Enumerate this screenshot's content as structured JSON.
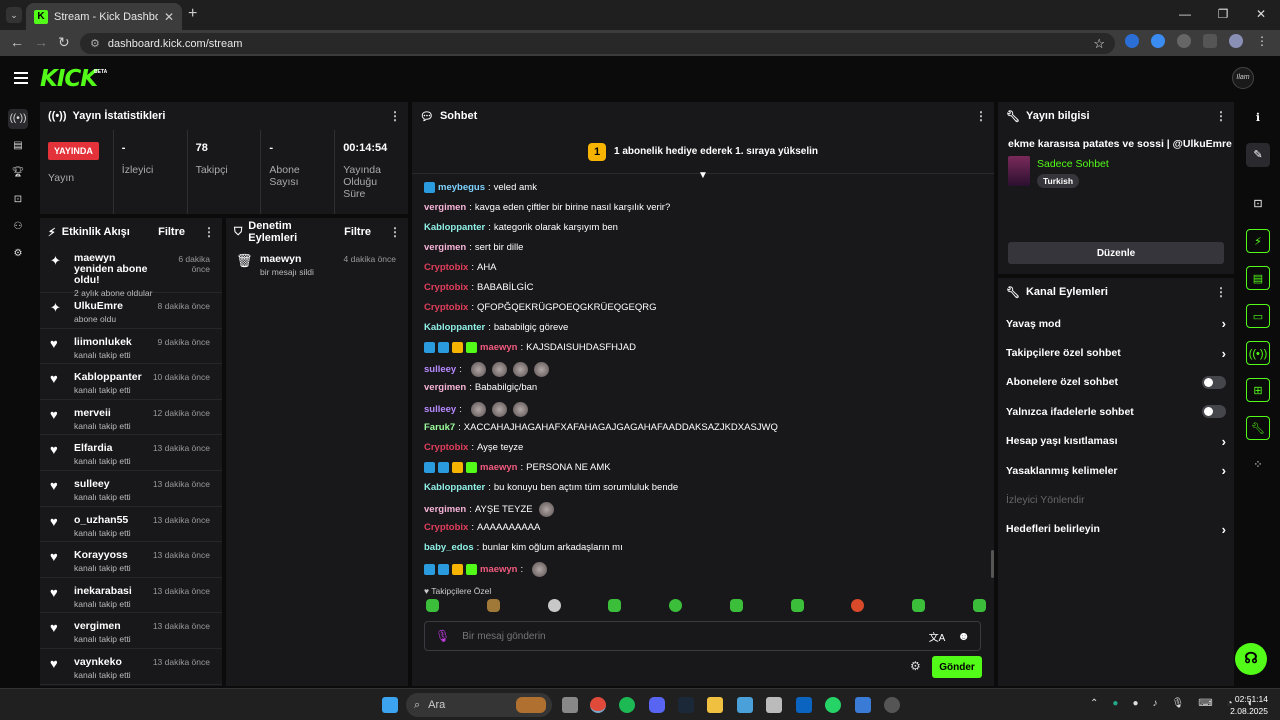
{
  "browser": {
    "tab_title": "Stream - Kick Dashboard",
    "url": "dashboard.kick.com/stream",
    "tab_favicon": "K"
  },
  "header": {
    "logo": "KICK",
    "beta": "BETA",
    "avatar_text": "Ilam"
  },
  "stats": {
    "title": "Yayın İstatistikleri",
    "live_badge": "YAYINDA",
    "cells": [
      {
        "value": "",
        "label": "Yayın"
      },
      {
        "value": "-",
        "label": "İzleyici"
      },
      {
        "value": "78",
        "label": "Takipçi"
      },
      {
        "value": "-",
        "label": "Abone Sayısı"
      },
      {
        "value": "00:14:54",
        "label": "Yayında Olduğu Süre"
      }
    ]
  },
  "activity": {
    "title": "Etkinlik Akışı",
    "filter": "Filtre",
    "items": [
      {
        "name": "maewyn yeniden abone oldu!",
        "sub": "2 aylık abone oldular",
        "time": "6 dakika önce",
        "icon": "sparkle-icon"
      },
      {
        "name": "UlkuEmre",
        "sub": "abone oldu",
        "time": "8 dakika önce",
        "icon": "sparkle-icon"
      },
      {
        "name": "liimonlukek",
        "sub": "kanalı takip etti",
        "time": "9 dakika önce",
        "icon": "heart-icon"
      },
      {
        "name": "Kabloppanter",
        "sub": "kanalı takip etti",
        "time": "10 dakika önce",
        "icon": "heart-icon"
      },
      {
        "name": "merveii",
        "sub": "kanalı takip etti",
        "time": "12 dakika önce",
        "icon": "heart-icon"
      },
      {
        "name": "Elfardia",
        "sub": "kanalı takip etti",
        "time": "13 dakika önce",
        "icon": "heart-icon"
      },
      {
        "name": "sulleey",
        "sub": "kanalı takip etti",
        "time": "13 dakika önce",
        "icon": "heart-icon"
      },
      {
        "name": "o_uzhan55",
        "sub": "kanalı takip etti",
        "time": "13 dakika önce",
        "icon": "heart-icon"
      },
      {
        "name": "Korayyoss",
        "sub": "kanalı takip etti",
        "time": "13 dakika önce",
        "icon": "heart-icon"
      },
      {
        "name": "inekarabasi",
        "sub": "kanalı takip etti",
        "time": "13 dakika önce",
        "icon": "heart-icon"
      },
      {
        "name": "vergimen",
        "sub": "kanalı takip etti",
        "time": "13 dakika önce",
        "icon": "heart-icon"
      },
      {
        "name": "vaynkeko",
        "sub": "kanalı takip etti",
        "time": "13 dakika önce",
        "icon": "heart-icon"
      }
    ]
  },
  "moderation": {
    "title": "Denetim Eylemleri",
    "filter": "Filtre",
    "items": [
      {
        "name": "maewyn",
        "sub": "bir mesajı sildi",
        "time": "4 dakika önce"
      }
    ]
  },
  "chat": {
    "title": "Sohbet",
    "pinned_coin": "1",
    "pinned_text": "1 abonelik hediye ederek 1. sıraya yükselin",
    "messages": [
      {
        "user": "meybegus",
        "color": "#7fd3ff",
        "text": "veled amk",
        "badges": [
          "#2b9be0"
        ]
      },
      {
        "user": "vergimen",
        "color": "#f7b4d7",
        "text": "kavga eden çiftler bir birine nasıl karşılık verir?"
      },
      {
        "user": "Kabloppanter",
        "color": "#8ff0e6",
        "text": "kategorik olarak karşıyım ben"
      },
      {
        "user": "vergimen",
        "color": "#f7b4d7",
        "text": "sert bir dille"
      },
      {
        "user": "Cryptobix",
        "color": "#e23e5b",
        "text": "AHA"
      },
      {
        "user": "Cryptobix",
        "color": "#e23e5b",
        "text": "BABABİLGİC"
      },
      {
        "user": "Cryptobix",
        "color": "#e23e5b",
        "text": "QFOPĞQEKRÜGPOEQGKRÜEQGEQRG"
      },
      {
        "user": "Kabloppanter",
        "color": "#8ff0e6",
        "text": "bababilgiç göreve"
      },
      {
        "user": "maewyn",
        "color": "#f25a7e",
        "text": "KAJSDAISUHDASFHJAD",
        "badges": [
          "#2b9be0",
          "#2b9be0",
          "#f6b400",
          "#53fc18"
        ]
      },
      {
        "user": "sulleey",
        "color": "#b78bff",
        "text": "",
        "emotes": 4
      },
      {
        "user": "vergimen",
        "color": "#f7b4d7",
        "text": "Bababilgiç/ban"
      },
      {
        "user": "sulleey",
        "color": "#b78bff",
        "text": "",
        "emotes": 3
      },
      {
        "user": "Faruk7",
        "color": "#9dff9d",
        "text": "XACCAHAJHAGAHAFXAFAHAGAJGAGAHAFAADDAKSAZJKDXASJWQ"
      },
      {
        "user": "Cryptobix",
        "color": "#e23e5b",
        "text": "Ayşe teyze"
      },
      {
        "user": "maewyn",
        "color": "#f25a7e",
        "text": "PERSONA NE AMK",
        "badges": [
          "#2b9be0",
          "#2b9be0",
          "#f6b400",
          "#53fc18"
        ]
      },
      {
        "user": "Kabloppanter",
        "color": "#8ff0e6",
        "text": "bu konuyu ben açtım tüm sorumluluk bende"
      },
      {
        "user": "vergimen",
        "color": "#f7b4d7",
        "text": "AYŞE TEYZE",
        "emotes": 1
      },
      {
        "user": "Cryptobix",
        "color": "#e23e5b",
        "text": "AAAAAAAAAA"
      },
      {
        "user": "baby_edos",
        "color": "#8ff0e6",
        "text": "bunlar kim oğlum arkadaşların mı"
      },
      {
        "user": "maewyn",
        "color": "#f25a7e",
        "text": "",
        "emotes": 1,
        "badges": [
          "#2b9be0",
          "#2b9be0",
          "#f6b400",
          "#53fc18"
        ]
      }
    ],
    "follower_only_label": "Takipçilere Özel",
    "input_placeholder": "Bir mesaj gönderin",
    "send_label": "Gönder"
  },
  "stream_info": {
    "title": "Yayın bilgisi",
    "stream_title": "ekme karasısa patates ve sossi | @UlkuEmre",
    "category": "Sadece Sohbet",
    "tag": "Turkish",
    "edit_label": "Düzenle"
  },
  "channel_actions": {
    "title": "Kanal Eylemleri",
    "rows": [
      {
        "label": "Yavaş mod",
        "kind": "chevron"
      },
      {
        "label": "Takipçilere özel sohbet",
        "kind": "chevron"
      },
      {
        "label": "Abonelere özel sohbet",
        "kind": "toggle"
      },
      {
        "label": "Yalnızca ifadelerle sohbet",
        "kind": "toggle"
      },
      {
        "label": "Hesap yaşı kısıtlaması",
        "kind": "chevron"
      },
      {
        "label": "Yasaklanmış kelimeler",
        "kind": "chevron"
      },
      {
        "label": "İzleyici Yönlendir",
        "kind": "disabled"
      },
      {
        "label": "Hedefleri belirleyin",
        "kind": "chevron"
      }
    ]
  },
  "taskbar": {
    "search_placeholder": "Ara",
    "time": "02:51:14",
    "date": "2.08.2025"
  },
  "colors": {
    "accent": "#53fc18",
    "live": "#e3323a",
    "panel": "#18181b"
  }
}
